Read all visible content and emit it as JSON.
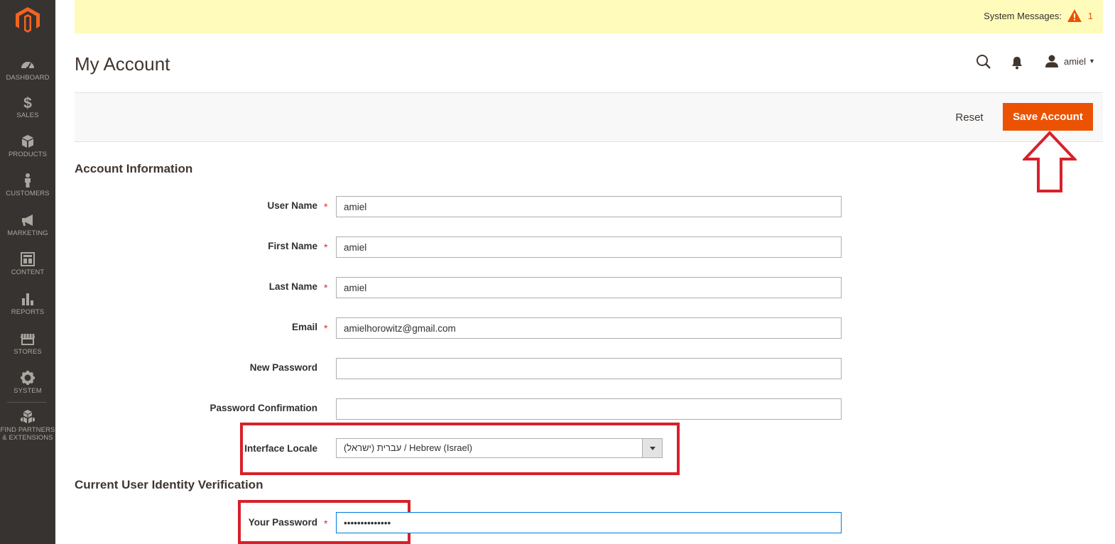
{
  "sidebar": {
    "items": [
      {
        "label": "DASHBOARD",
        "icon": "dashboard-icon"
      },
      {
        "label": "SALES",
        "icon": "dollar-icon"
      },
      {
        "label": "PRODUCTS",
        "icon": "cube-icon"
      },
      {
        "label": "CUSTOMERS",
        "icon": "person-icon"
      },
      {
        "label": "MARKETING",
        "icon": "megaphone-icon"
      },
      {
        "label": "CONTENT",
        "icon": "layout-icon"
      },
      {
        "label": "REPORTS",
        "icon": "bar-chart-icon"
      },
      {
        "label": "STORES",
        "icon": "storefront-icon"
      },
      {
        "label": "SYSTEM",
        "icon": "gear-icon"
      },
      {
        "label": "FIND PARTNERS",
        "label2": "& EXTENSIONS",
        "icon": "boxes-icon"
      }
    ]
  },
  "system_messages": {
    "label": "System Messages:",
    "count": "1"
  },
  "header": {
    "title": "My Account",
    "username": "amiel"
  },
  "actions": {
    "reset_label": "Reset",
    "save_label": "Save Account"
  },
  "sections": {
    "account_info": "Account Information",
    "verification": "Current User Identity Verification"
  },
  "fields": {
    "user_name": {
      "label": "User Name",
      "value": "amiel"
    },
    "first_name": {
      "label": "First Name",
      "value": "amiel"
    },
    "last_name": {
      "label": "Last Name",
      "value": "amiel"
    },
    "email": {
      "label": "Email",
      "value": "amielhorowitz@gmail.com"
    },
    "new_password": {
      "label": "New Password",
      "value": ""
    },
    "password_confirmation": {
      "label": "Password Confirmation",
      "value": ""
    },
    "interface_locale": {
      "label": "Interface Locale",
      "value": "עברית (ישראל) / Hebrew (Israel)"
    },
    "your_password": {
      "label": "Your Password",
      "value": "••••••••••••••"
    }
  },
  "required_mark": "*",
  "colors": {
    "sidebar_bg": "#373330",
    "accent": "#eb5202",
    "sysbar_bg": "#fffbbb",
    "annotation_red": "#d8202a"
  }
}
